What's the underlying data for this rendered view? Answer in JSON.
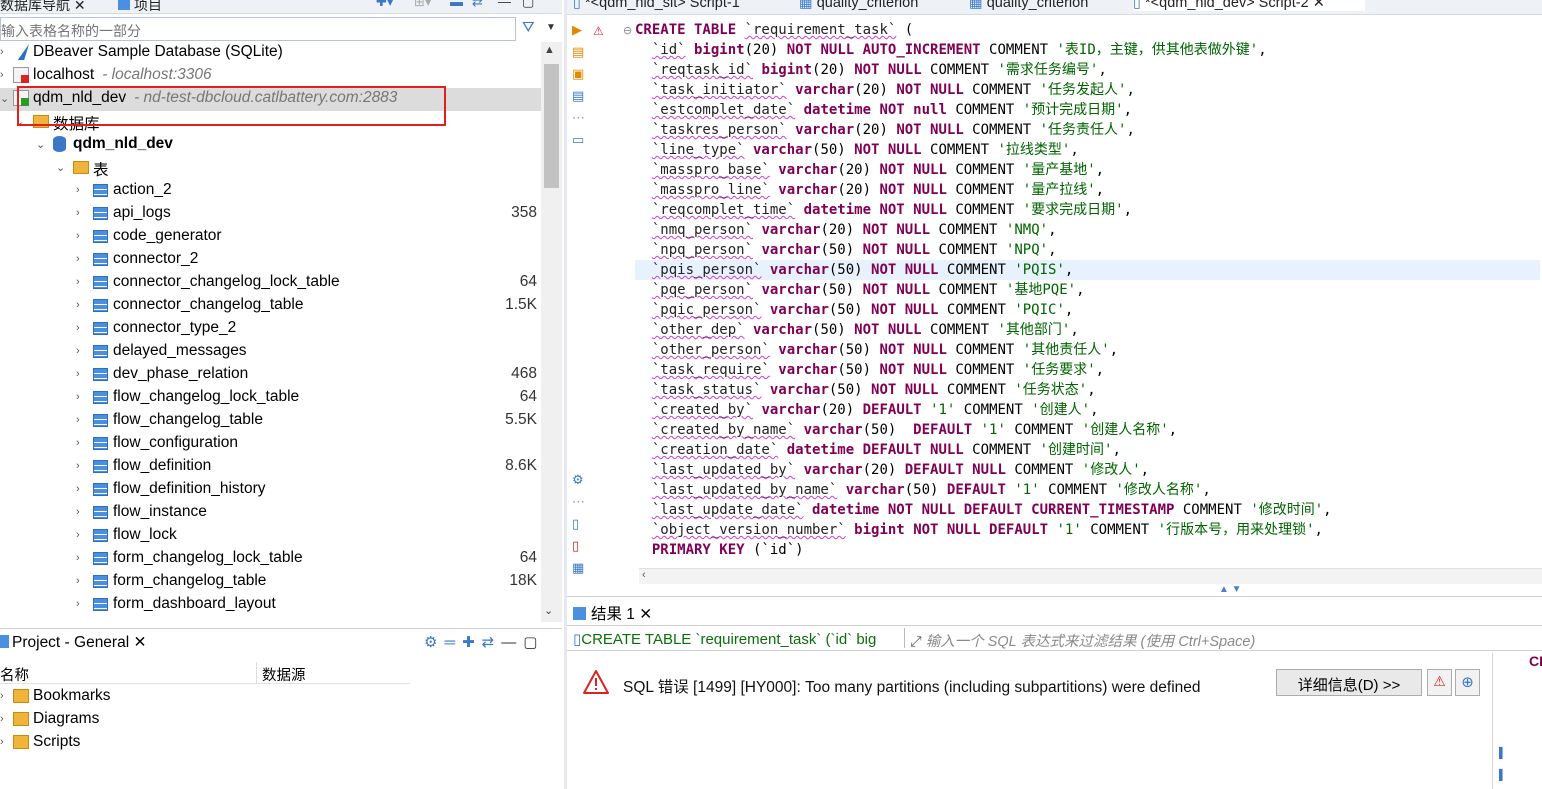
{
  "nav": {
    "tabs": [
      {
        "label": "数据库导航",
        "close": "✕"
      },
      {
        "label": "项目"
      }
    ],
    "filter_placeholder": "输入表格名称的一部分",
    "connections": [
      {
        "label": "DBeaver Sample Database (SQLite)"
      },
      {
        "label": "localhost",
        "host": "- localhost:3306"
      },
      {
        "label": "qdm_nld_dev",
        "host": "- nd-test-dbcloud.catlbattery.com:2883"
      }
    ],
    "folder_label": "数据库",
    "database_label": "qdm_nld_dev",
    "tables_folder_label": "表",
    "tables": [
      {
        "name": "action_2",
        "count": ""
      },
      {
        "name": "api_logs",
        "count": "358"
      },
      {
        "name": "code_generator",
        "count": ""
      },
      {
        "name": "connector_2",
        "count": ""
      },
      {
        "name": "connector_changelog_lock_table",
        "count": "64"
      },
      {
        "name": "connector_changelog_table",
        "count": "1.5K"
      },
      {
        "name": "connector_type_2",
        "count": ""
      },
      {
        "name": "delayed_messages",
        "count": ""
      },
      {
        "name": "dev_phase_relation",
        "count": "468"
      },
      {
        "name": "flow_changelog_lock_table",
        "count": "64"
      },
      {
        "name": "flow_changelog_table",
        "count": "5.5K"
      },
      {
        "name": "flow_configuration",
        "count": ""
      },
      {
        "name": "flow_definition",
        "count": "8.6K"
      },
      {
        "name": "flow_definition_history",
        "count": ""
      },
      {
        "name": "flow_instance",
        "count": ""
      },
      {
        "name": "flow_lock",
        "count": ""
      },
      {
        "name": "form_changelog_lock_table",
        "count": "64"
      },
      {
        "name": "form_changelog_table",
        "count": "18K"
      },
      {
        "name": "form_dashboard_layout",
        "count": ""
      }
    ]
  },
  "project": {
    "tab_label": "Project - General",
    "col_name": "名称",
    "col_datasource": "数据源",
    "items": [
      {
        "label": "Bookmarks"
      },
      {
        "label": "Diagrams"
      },
      {
        "label": "Scripts"
      }
    ]
  },
  "editor": {
    "tabs": [
      {
        "label": "*<qdm_nld_sit> Script-1"
      },
      {
        "label": "quality_criterion"
      },
      {
        "label": "quality_criterion"
      },
      {
        "label": "*<qdm_nld_dev> Script-2"
      }
    ],
    "lines": [
      [
        {
          "t": "CREATE TABLE ",
          "c": "kw"
        },
        {
          "t": "`requirement_task`",
          "c": "id"
        },
        {
          "t": " (",
          "c": ""
        }
      ],
      [
        {
          "t": "  ",
          "c": ""
        },
        {
          "t": "`id`",
          "c": "id"
        },
        {
          "t": " bigint",
          "c": "kw"
        },
        {
          "t": "(20) ",
          "c": ""
        },
        {
          "t": "NOT NULL AUTO_INCREMENT",
          "c": "kw"
        },
        {
          "t": " COMMENT ",
          "c": ""
        },
        {
          "t": "'表ID，主键，供其他表做外键'",
          "c": "cmt"
        },
        {
          "t": ",",
          "c": ""
        }
      ],
      [
        {
          "t": "  ",
          "c": ""
        },
        {
          "t": "`reqtask_id`",
          "c": "id"
        },
        {
          "t": " bigint",
          "c": "kw"
        },
        {
          "t": "(20) ",
          "c": ""
        },
        {
          "t": "NOT NULL",
          "c": "kw"
        },
        {
          "t": " COMMENT ",
          "c": ""
        },
        {
          "t": "'需求任务编号'",
          "c": "cmt"
        },
        {
          "t": ",",
          "c": ""
        }
      ],
      [
        {
          "t": "  ",
          "c": ""
        },
        {
          "t": "`task_initiator`",
          "c": "id"
        },
        {
          "t": " varchar",
          "c": "kw"
        },
        {
          "t": "(20) ",
          "c": ""
        },
        {
          "t": "NOT NULL",
          "c": "kw"
        },
        {
          "t": " COMMENT ",
          "c": ""
        },
        {
          "t": "'任务发起人'",
          "c": "cmt"
        },
        {
          "t": ",",
          "c": ""
        }
      ],
      [
        {
          "t": "  ",
          "c": ""
        },
        {
          "t": "`estcomplet_date`",
          "c": "id"
        },
        {
          "t": " datetime",
          "c": "kw"
        },
        {
          "t": " ",
          "c": ""
        },
        {
          "t": "NOT null",
          "c": "kw"
        },
        {
          "t": " COMMENT ",
          "c": ""
        },
        {
          "t": "'预计完成日期'",
          "c": "cmt"
        },
        {
          "t": ",",
          "c": ""
        }
      ],
      [
        {
          "t": "  ",
          "c": ""
        },
        {
          "t": "`taskres_person`",
          "c": "id"
        },
        {
          "t": " varchar",
          "c": "kw"
        },
        {
          "t": "(20) ",
          "c": ""
        },
        {
          "t": "NOT NULL",
          "c": "kw"
        },
        {
          "t": " COMMENT ",
          "c": ""
        },
        {
          "t": "'任务责任人'",
          "c": "cmt"
        },
        {
          "t": ",",
          "c": ""
        }
      ],
      [
        {
          "t": "  ",
          "c": ""
        },
        {
          "t": "`line_type`",
          "c": "id"
        },
        {
          "t": " varchar",
          "c": "kw"
        },
        {
          "t": "(50) ",
          "c": ""
        },
        {
          "t": "NOT NULL",
          "c": "kw"
        },
        {
          "t": " COMMENT ",
          "c": ""
        },
        {
          "t": "'拉线类型'",
          "c": "cmt"
        },
        {
          "t": ",",
          "c": ""
        }
      ],
      [
        {
          "t": "  ",
          "c": ""
        },
        {
          "t": "`masspro_base`",
          "c": "id"
        },
        {
          "t": " varchar",
          "c": "kw"
        },
        {
          "t": "(20) ",
          "c": ""
        },
        {
          "t": "NOT NULL",
          "c": "kw"
        },
        {
          "t": " COMMENT ",
          "c": ""
        },
        {
          "t": "'量产基地'",
          "c": "cmt"
        },
        {
          "t": ",",
          "c": ""
        }
      ],
      [
        {
          "t": "  ",
          "c": ""
        },
        {
          "t": "`masspro_line`",
          "c": "id"
        },
        {
          "t": " varchar",
          "c": "kw"
        },
        {
          "t": "(20) ",
          "c": ""
        },
        {
          "t": "NOT NULL",
          "c": "kw"
        },
        {
          "t": " COMMENT ",
          "c": ""
        },
        {
          "t": "'量产拉线'",
          "c": "cmt"
        },
        {
          "t": ",",
          "c": ""
        }
      ],
      [
        {
          "t": "  ",
          "c": ""
        },
        {
          "t": "`reqcomplet_time`",
          "c": "id"
        },
        {
          "t": " datetime",
          "c": "kw"
        },
        {
          "t": " ",
          "c": ""
        },
        {
          "t": "NOT NULL",
          "c": "kw"
        },
        {
          "t": " COMMENT ",
          "c": ""
        },
        {
          "t": "'要求完成日期'",
          "c": "cmt"
        },
        {
          "t": ",",
          "c": ""
        }
      ],
      [
        {
          "t": "  ",
          "c": ""
        },
        {
          "t": "`nmq_person`",
          "c": "id"
        },
        {
          "t": " varchar",
          "c": "kw"
        },
        {
          "t": "(20) ",
          "c": ""
        },
        {
          "t": "NOT NULL",
          "c": "kw"
        },
        {
          "t": " COMMENT ",
          "c": ""
        },
        {
          "t": "'NMQ'",
          "c": "cmt"
        },
        {
          "t": ",",
          "c": ""
        }
      ],
      [
        {
          "t": "  ",
          "c": ""
        },
        {
          "t": "`npq_person`",
          "c": "id"
        },
        {
          "t": " varchar",
          "c": "kw"
        },
        {
          "t": "(50) ",
          "c": ""
        },
        {
          "t": "NOT NULL",
          "c": "kw"
        },
        {
          "t": " COMMENT ",
          "c": ""
        },
        {
          "t": "'NPQ'",
          "c": "cmt"
        },
        {
          "t": ",",
          "c": ""
        }
      ],
      [
        {
          "t": "  ",
          "c": ""
        },
        {
          "t": "`pqis_person`",
          "c": "id"
        },
        {
          "t": " varchar",
          "c": "kw"
        },
        {
          "t": "(50) ",
          "c": ""
        },
        {
          "t": "NOT NULL",
          "c": "kw"
        },
        {
          "t": " COMMENT ",
          "c": ""
        },
        {
          "t": "'PQIS'",
          "c": "cmt"
        },
        {
          "t": ",",
          "c": ""
        }
      ],
      [
        {
          "t": "  ",
          "c": ""
        },
        {
          "t": "`pqe_person`",
          "c": "id"
        },
        {
          "t": " varchar",
          "c": "kw"
        },
        {
          "t": "(50) ",
          "c": ""
        },
        {
          "t": "NOT NULL",
          "c": "kw"
        },
        {
          "t": " COMMENT ",
          "c": ""
        },
        {
          "t": "'基地PQE'",
          "c": "cmt"
        },
        {
          "t": ",",
          "c": ""
        }
      ],
      [
        {
          "t": "  ",
          "c": ""
        },
        {
          "t": "`pqic_person`",
          "c": "id"
        },
        {
          "t": " varchar",
          "c": "kw"
        },
        {
          "t": "(50) ",
          "c": ""
        },
        {
          "t": "NOT NULL",
          "c": "kw"
        },
        {
          "t": " COMMENT ",
          "c": ""
        },
        {
          "t": "'PQIC'",
          "c": "cmt"
        },
        {
          "t": ",",
          "c": ""
        }
      ],
      [
        {
          "t": "  ",
          "c": ""
        },
        {
          "t": "`other_dep`",
          "c": "id"
        },
        {
          "t": " varchar",
          "c": "kw"
        },
        {
          "t": "(50) ",
          "c": ""
        },
        {
          "t": "NOT NULL",
          "c": "kw"
        },
        {
          "t": " COMMENT ",
          "c": ""
        },
        {
          "t": "'其他部门'",
          "c": "cmt"
        },
        {
          "t": ",",
          "c": ""
        }
      ],
      [
        {
          "t": "  ",
          "c": ""
        },
        {
          "t": "`other_person`",
          "c": "id"
        },
        {
          "t": " varchar",
          "c": "kw"
        },
        {
          "t": "(50) ",
          "c": ""
        },
        {
          "t": "NOT NULL",
          "c": "kw"
        },
        {
          "t": " COMMENT ",
          "c": ""
        },
        {
          "t": "'其他责任人'",
          "c": "cmt"
        },
        {
          "t": ",",
          "c": ""
        }
      ],
      [
        {
          "t": "  ",
          "c": ""
        },
        {
          "t": "`task_require`",
          "c": "id"
        },
        {
          "t": " varchar",
          "c": "kw"
        },
        {
          "t": "(50) ",
          "c": ""
        },
        {
          "t": "NOT NULL",
          "c": "kw"
        },
        {
          "t": " COMMENT ",
          "c": ""
        },
        {
          "t": "'任务要求'",
          "c": "cmt"
        },
        {
          "t": ",",
          "c": ""
        }
      ],
      [
        {
          "t": "  ",
          "c": ""
        },
        {
          "t": "`task_status`",
          "c": "id"
        },
        {
          "t": " varchar",
          "c": "kw"
        },
        {
          "t": "(50) ",
          "c": ""
        },
        {
          "t": "NOT NULL",
          "c": "kw"
        },
        {
          "t": " COMMENT ",
          "c": ""
        },
        {
          "t": "'任务状态'",
          "c": "cmt"
        },
        {
          "t": ",",
          "c": ""
        }
      ],
      [
        {
          "t": "  ",
          "c": ""
        },
        {
          "t": "`created_by`",
          "c": "id"
        },
        {
          "t": " varchar",
          "c": "kw"
        },
        {
          "t": "(20) ",
          "c": ""
        },
        {
          "t": "DEFAULT",
          "c": "kw"
        },
        {
          "t": " ",
          "c": ""
        },
        {
          "t": "'1'",
          "c": "cmt"
        },
        {
          "t": " COMMENT ",
          "c": ""
        },
        {
          "t": "'创建人'",
          "c": "cmt"
        },
        {
          "t": ",",
          "c": ""
        }
      ],
      [
        {
          "t": "  ",
          "c": ""
        },
        {
          "t": "`created_by_name`",
          "c": "id"
        },
        {
          "t": " varchar",
          "c": "kw"
        },
        {
          "t": "(50)  ",
          "c": ""
        },
        {
          "t": "DEFAULT",
          "c": "kw"
        },
        {
          "t": " ",
          "c": ""
        },
        {
          "t": "'1'",
          "c": "cmt"
        },
        {
          "t": " COMMENT ",
          "c": ""
        },
        {
          "t": "'创建人名称'",
          "c": "cmt"
        },
        {
          "t": ",",
          "c": ""
        }
      ],
      [
        {
          "t": "  ",
          "c": ""
        },
        {
          "t": "`creation_date`",
          "c": "id"
        },
        {
          "t": " datetime",
          "c": "kw"
        },
        {
          "t": " ",
          "c": ""
        },
        {
          "t": "DEFAULT NULL",
          "c": "kw"
        },
        {
          "t": " COMMENT ",
          "c": ""
        },
        {
          "t": "'创建时间'",
          "c": "cmt"
        },
        {
          "t": ",",
          "c": ""
        }
      ],
      [
        {
          "t": "  ",
          "c": ""
        },
        {
          "t": "`last_updated_by`",
          "c": "id"
        },
        {
          "t": " varchar",
          "c": "kw"
        },
        {
          "t": "(20) ",
          "c": ""
        },
        {
          "t": "DEFAULT NULL",
          "c": "kw"
        },
        {
          "t": " COMMENT ",
          "c": ""
        },
        {
          "t": "'修改人'",
          "c": "cmt"
        },
        {
          "t": ",",
          "c": ""
        }
      ],
      [
        {
          "t": "  ",
          "c": ""
        },
        {
          "t": "`last_updated_by_name`",
          "c": "id"
        },
        {
          "t": " varchar",
          "c": "kw"
        },
        {
          "t": "(50) ",
          "c": ""
        },
        {
          "t": "DEFAULT",
          "c": "kw"
        },
        {
          "t": " ",
          "c": ""
        },
        {
          "t": "'1'",
          "c": "cmt"
        },
        {
          "t": " COMMENT ",
          "c": ""
        },
        {
          "t": "'修改人名称'",
          "c": "cmt"
        },
        {
          "t": ",",
          "c": ""
        }
      ],
      [
        {
          "t": "  ",
          "c": ""
        },
        {
          "t": "`last_update_date`",
          "c": "id"
        },
        {
          "t": " datetime",
          "c": "kw"
        },
        {
          "t": " ",
          "c": ""
        },
        {
          "t": "NOT NULL DEFAULT CURRENT_TIMESTAMP",
          "c": "kw"
        },
        {
          "t": " COMMENT ",
          "c": ""
        },
        {
          "t": "'修改时间'",
          "c": "cmt"
        },
        {
          "t": ",",
          "c": ""
        }
      ],
      [
        {
          "t": "  ",
          "c": ""
        },
        {
          "t": "`object_version_number`",
          "c": "id"
        },
        {
          "t": " bigint",
          "c": "kw"
        },
        {
          "t": " ",
          "c": ""
        },
        {
          "t": "NOT NULL DEFAULT",
          "c": "kw"
        },
        {
          "t": " ",
          "c": ""
        },
        {
          "t": "'1'",
          "c": "cmt"
        },
        {
          "t": " COMMENT ",
          "c": ""
        },
        {
          "t": "'行版本号，用来处理锁'",
          "c": "cmt"
        },
        {
          "t": ",",
          "c": ""
        }
      ],
      [
        {
          "t": "  ",
          "c": ""
        },
        {
          "t": "PRIMARY KEY",
          "c": "kw"
        },
        {
          "t": " (`id`)",
          "c": ""
        }
      ]
    ],
    "current_line_index": 12
  },
  "results": {
    "tab_label": "结果 1",
    "query_preview": "CREATE TABLE `requirement_task` (`id` big",
    "filter_placeholder": "输入一个 SQL 表达式来过滤结果 (使用 Ctrl+Space)",
    "error_message": "SQL 错误 [1499] [HY000]: Too many partitions (including subpartitions) were defined",
    "details_button": "详细信息(D) >>",
    "side_text": "CR"
  },
  "colors": {
    "keyword": "#7f0055",
    "comment_string": "#006400",
    "highlight_box": "#e02020",
    "accent": "#3a77c9"
  }
}
